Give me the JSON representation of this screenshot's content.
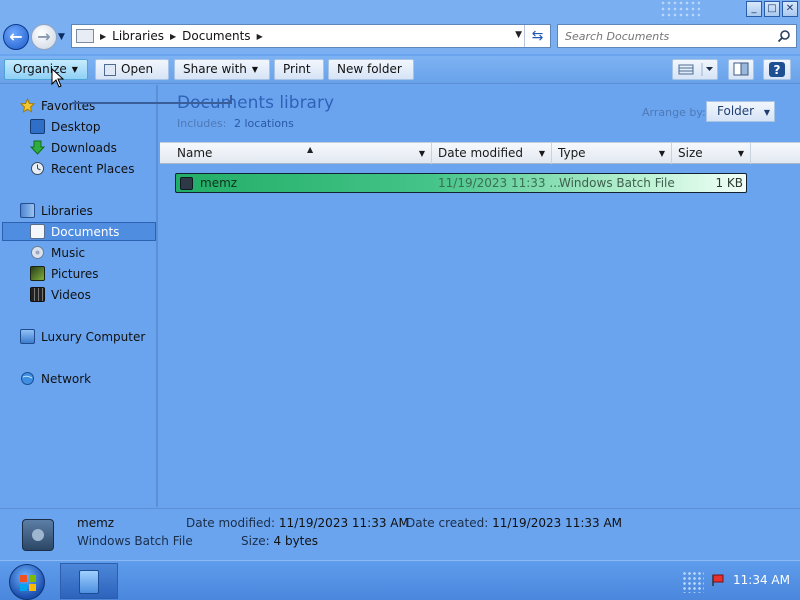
{
  "window": {
    "minimize": "_",
    "maximize": "□",
    "close": "✕"
  },
  "address": {
    "crumbs": [
      "Libraries",
      "Documents"
    ],
    "search_placeholder": "Search Documents"
  },
  "toolbar": {
    "organize": "Organize",
    "open": "Open",
    "share_with": "Share with",
    "print": "Print",
    "new_folder": "New folder"
  },
  "nav": {
    "favorites": "Favorites",
    "desktop": "Desktop",
    "downloads": "Downloads",
    "recent_places": "Recent Places",
    "libraries": "Libraries",
    "documents": "Documents",
    "music": "Music",
    "pictures": "Pictures",
    "videos": "Videos",
    "computer": "Luxury Computer",
    "network": "Network"
  },
  "library": {
    "title": "Documents library",
    "includes_label": "Includes:",
    "includes_link": "2 locations",
    "arrange_label": "Arrange by:",
    "arrange_value": "Folder"
  },
  "columns": {
    "name": "Name",
    "date_modified": "Date modified",
    "type": "Type",
    "size": "Size"
  },
  "files": [
    {
      "name": "memz",
      "date_modified": "11/19/2023 11:33 ...",
      "type": "Windows Batch File",
      "size": "1 KB"
    }
  ],
  "details": {
    "name": "memz",
    "type": "Windows Batch File",
    "date_modified_label": "Date modified:",
    "date_modified": "11/19/2023 11:33 AM",
    "date_created_label": "Date created:",
    "date_created": "11/19/2023 11:33 AM",
    "size_label": "Size:",
    "size": "4 bytes"
  },
  "taskbar": {
    "clock": "11:34 AM"
  },
  "colors": {
    "background": "#6aa4ee",
    "selection": "#4f8de0",
    "file_row_highlight": "#22ae66",
    "link": "#2f62b8"
  }
}
